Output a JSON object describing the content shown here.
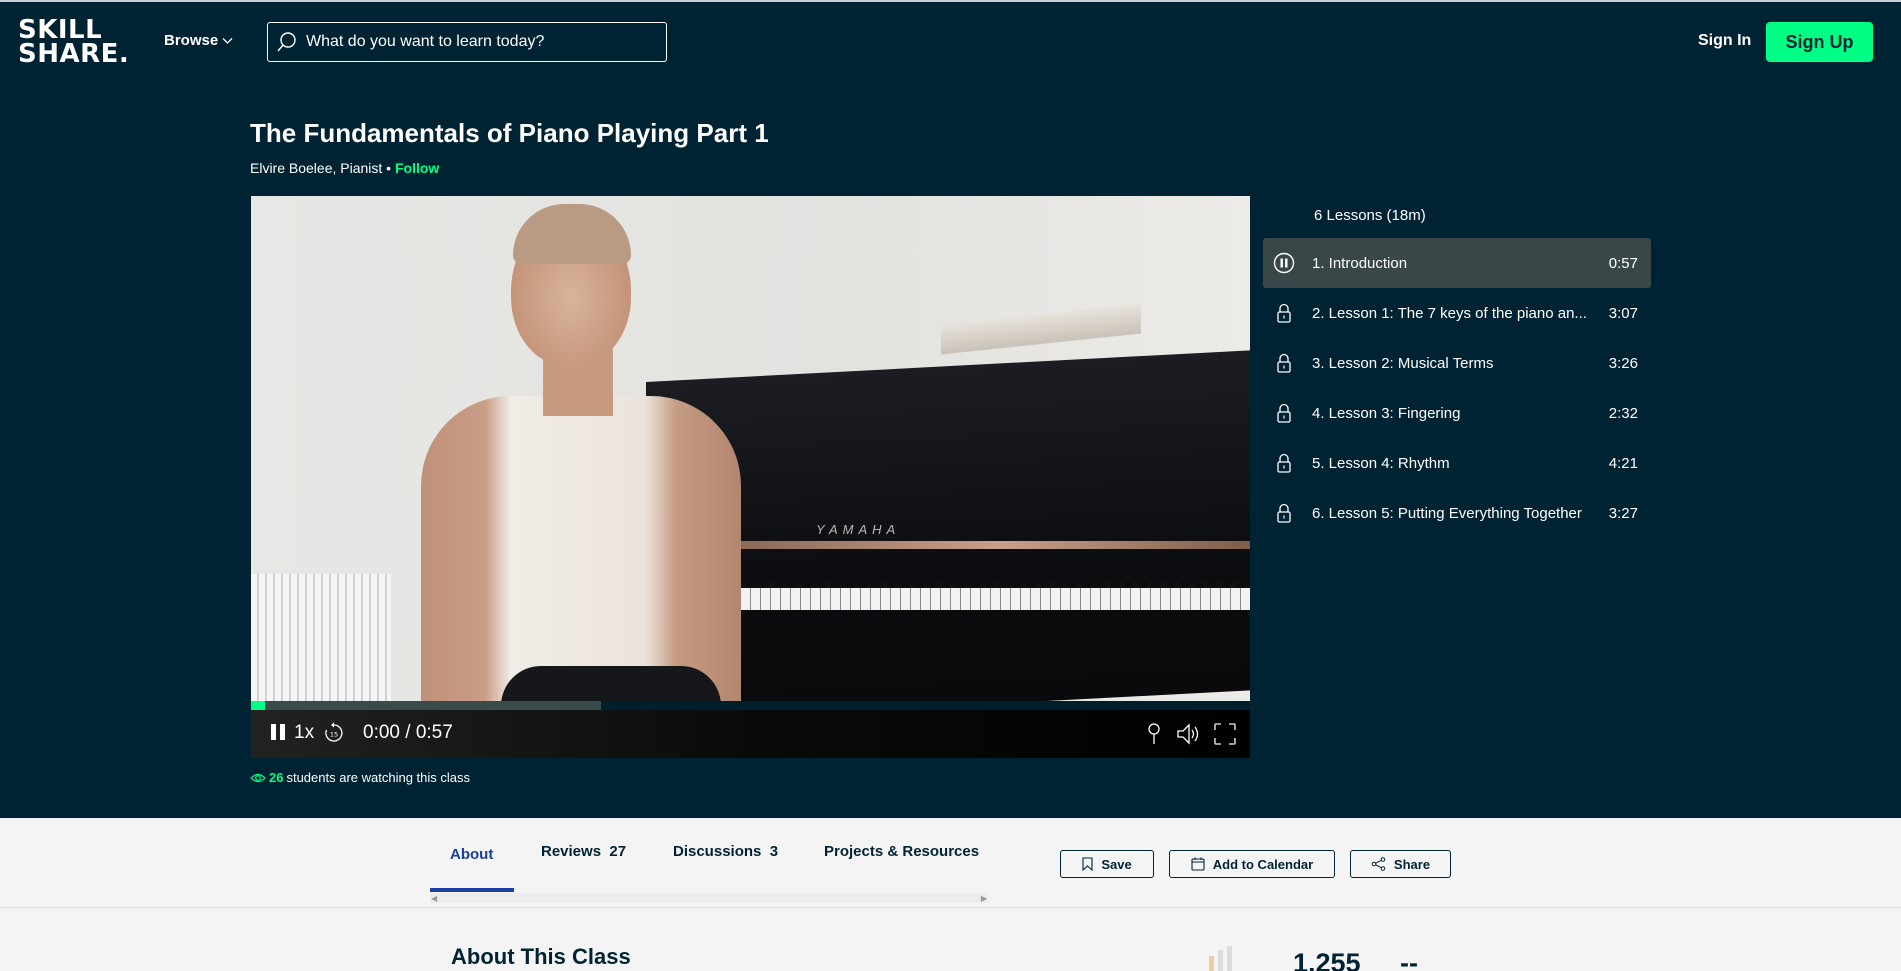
{
  "header": {
    "logo_line1": "SKILL",
    "logo_line2": "SHARE.",
    "browse_label": "Browse",
    "search_placeholder": "What do you want to learn today?",
    "signin_label": "Sign In",
    "signup_label": "Sign Up",
    "accent_color": "#00ff84",
    "background_color": "#002333"
  },
  "course": {
    "title": "The Fundamentals of Piano Playing Part 1",
    "teacher": "Elvire Boelee, Pianist",
    "separator": " • ",
    "follow_label": "Follow"
  },
  "video": {
    "scene_label": "YAMAHA",
    "speed": "1x",
    "rewind_seconds": "15",
    "time_display": "0:00 / 0:57",
    "played_fraction": 0.014,
    "buffered_fraction": 0.35,
    "state": "playing"
  },
  "watching": {
    "count": "26",
    "text": "students are watching this class"
  },
  "lessons": {
    "header": "6 Lessons (18m)",
    "items": [
      {
        "title": "1. Introduction",
        "duration": "0:57",
        "state": "playing"
      },
      {
        "title": "2. Lesson 1: The 7 keys of the piano an...",
        "duration": "3:07",
        "state": "locked"
      },
      {
        "title": "3. Lesson 2: Musical Terms",
        "duration": "3:26",
        "state": "locked"
      },
      {
        "title": "4. Lesson 3: Fingering",
        "duration": "2:32",
        "state": "locked"
      },
      {
        "title": "5. Lesson 4: Rhythm",
        "duration": "4:21",
        "state": "locked"
      },
      {
        "title": "6. Lesson 5: Putting Everything Together",
        "duration": "3:27",
        "state": "locked"
      }
    ]
  },
  "tabs": [
    {
      "label": "About",
      "count": "",
      "active": true
    },
    {
      "label": "Reviews",
      "count": "27",
      "active": false
    },
    {
      "label": "Discussions",
      "count": "3",
      "active": false
    },
    {
      "label": "Projects & Resources",
      "count": "",
      "active": false
    }
  ],
  "actions": {
    "save_label": "Save",
    "calendar_label": "Add to Calendar",
    "share_label": "Share"
  },
  "about": {
    "title": "About This Class",
    "students_count": "1,255",
    "projects_count": "--"
  }
}
